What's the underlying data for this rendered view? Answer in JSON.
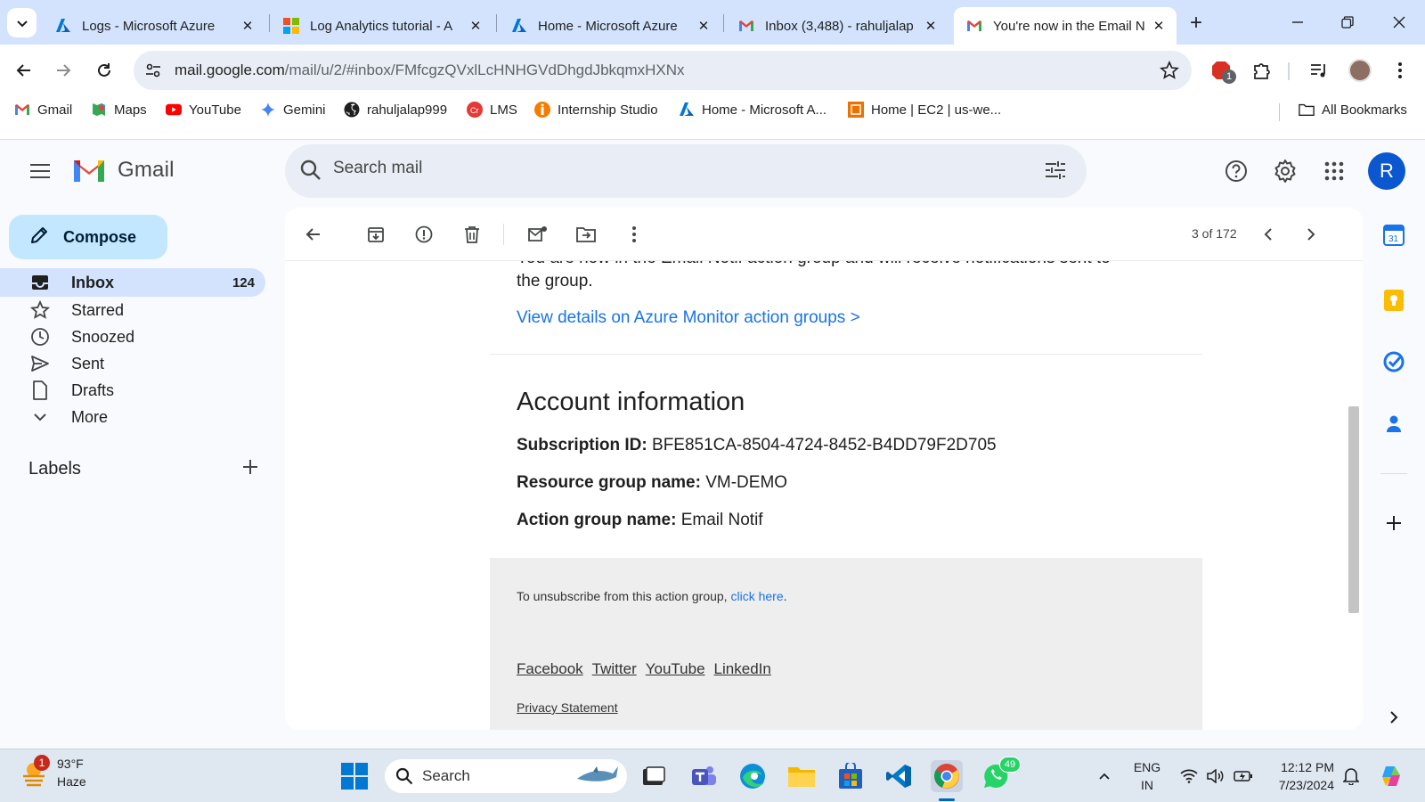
{
  "browser": {
    "tabs": [
      {
        "title": "Logs - Microsoft Azure"
      },
      {
        "title": "Log Analytics tutorial - A"
      },
      {
        "title": "Home - Microsoft Azure"
      },
      {
        "title": "Inbox (3,488) - rahuljalap"
      },
      {
        "title": "You're now in the Email N"
      }
    ],
    "url_host": "mail.google.com",
    "url_path": "/mail/u/2/#inbox/FMfcgzQVxlLcHNHGVdDhgdJbkqmxHXNx",
    "extension_badge": "1",
    "bookmarks": [
      {
        "label": "Gmail"
      },
      {
        "label": "Maps"
      },
      {
        "label": "YouTube"
      },
      {
        "label": "Gemini"
      },
      {
        "label": "rahuljalap999"
      },
      {
        "label": "LMS"
      },
      {
        "label": "Internship Studio"
      },
      {
        "label": "Home - Microsoft A..."
      },
      {
        "label": "Home | EC2 | us-we..."
      }
    ],
    "all_bookmarks": "All Bookmarks"
  },
  "gmail": {
    "wordmark": "Gmail",
    "search_placeholder": "Search mail",
    "avatar_letter": "R",
    "compose": "Compose",
    "nav": [
      {
        "label": "Inbox",
        "count": "124"
      },
      {
        "label": "Starred"
      },
      {
        "label": "Snoozed"
      },
      {
        "label": "Sent"
      },
      {
        "label": "Drafts"
      },
      {
        "label": "More"
      }
    ],
    "labels_heading": "Labels",
    "pager": "3 of 172"
  },
  "email": {
    "cut_line": "You are now in the Email Notif action group and will receive notifications sent to",
    "cut_line2": "the group.",
    "view_link": "View details on Azure Monitor action groups >",
    "account_title": "Account information",
    "subscription_label": "Subscription ID:",
    "subscription_value": "BFE851CA-8504-4724-8452-B4DD79F2D705",
    "resource_group_label": "Resource group name:",
    "resource_group_value": "VM-DEMO",
    "action_group_label": "Action group name:",
    "action_group_value": "Email Notif",
    "unsub_text": "To unsubscribe from this action group,",
    "unsub_link": "click here",
    "social": [
      "Facebook",
      "Twitter",
      "YouTube",
      "LinkedIn"
    ],
    "privacy": "Privacy Statement"
  },
  "taskbar": {
    "weather_temp": "93°F",
    "weather_desc": "Haze",
    "weather_badge": "1",
    "search": "Search",
    "whatsapp_badge": "49",
    "lang1": "ENG",
    "lang2": "IN",
    "time": "12:12 PM",
    "date": "7/23/2024"
  },
  "colors": {
    "tabstrip": "#d3e3fd",
    "compose": "#c2e7ff",
    "link": "#1a73e8",
    "avatar": "#0b57d0"
  }
}
